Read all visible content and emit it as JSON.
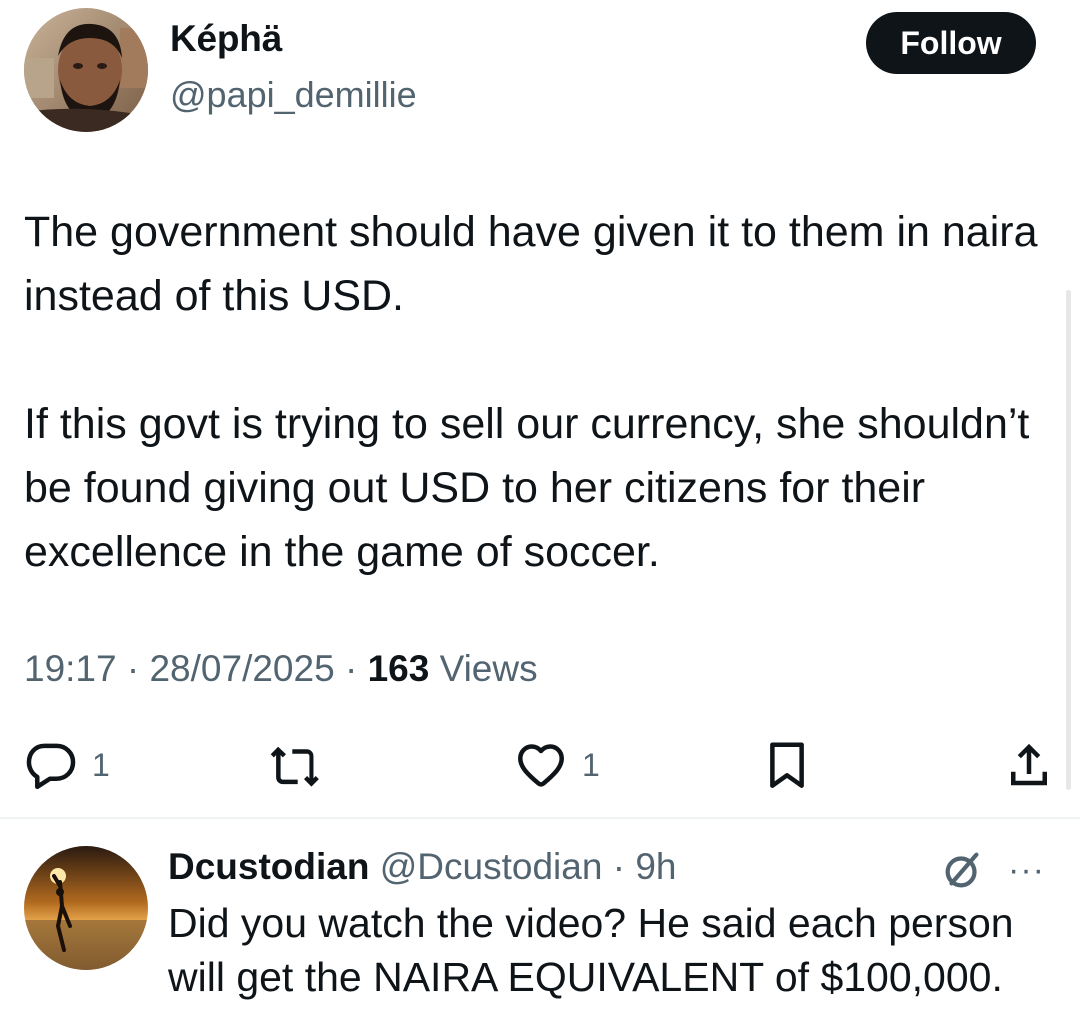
{
  "tweet": {
    "author": {
      "name": "Képhä",
      "handle": "@papi_demillie"
    },
    "follow_label": "Follow",
    "paragraph1": "The government should have given it to them in naira instead of this USD.",
    "paragraph2": "If this govt is trying to sell our currency, she shouldn’t be found giving out USD to her citizens for their excellence in the game of soccer.",
    "time": "19:17",
    "date": "28/07/2025",
    "separator": "·",
    "views_count": "163",
    "views_label": "Views",
    "actions": {
      "reply_count": "1",
      "like_count": "1"
    }
  },
  "reply": {
    "name": "Dcustodian",
    "handle": "@Dcustodian",
    "separator": "·",
    "time": "9h",
    "more_glyph": "···",
    "text": "Did you watch the video? He said each person will get the NAIRA EQUIVALENT of $100,000."
  },
  "icons": [
    "reply-icon",
    "retweet-icon",
    "like-icon",
    "bookmark-icon",
    "share-icon",
    "grok-icon",
    "more-icon"
  ],
  "colors": {
    "text": "#0f1419",
    "secondary": "#536471",
    "button": "#0f1419",
    "divider": "#eff3f4"
  }
}
